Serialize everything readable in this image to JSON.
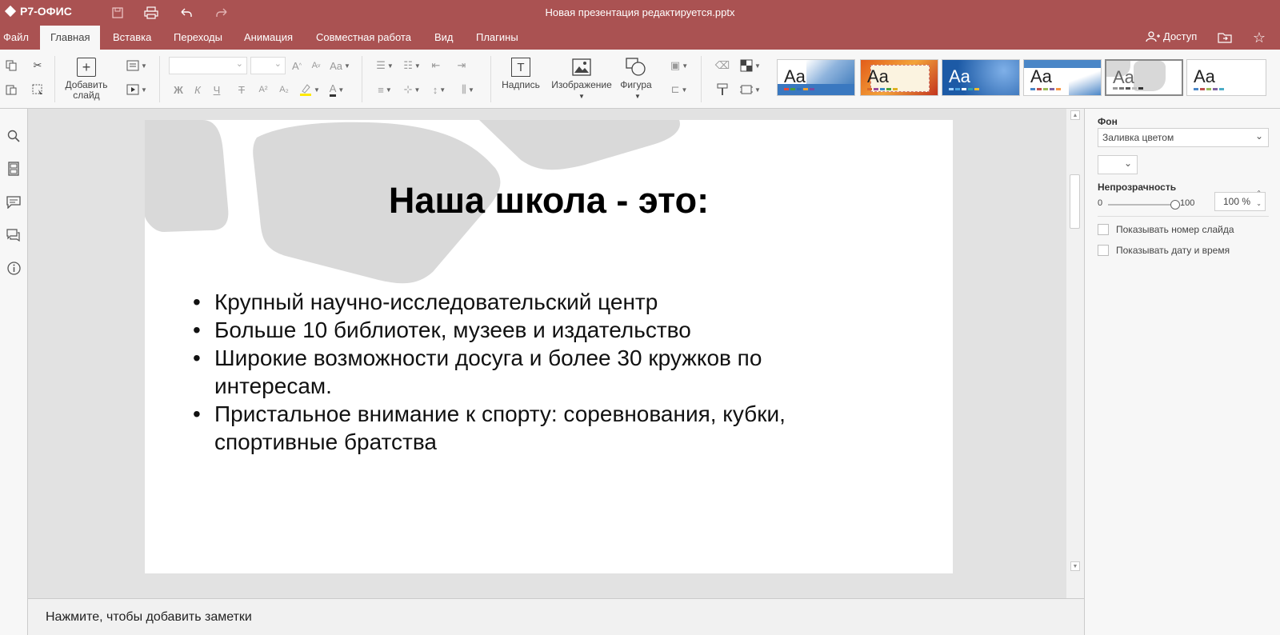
{
  "app": {
    "logo": "Р7-ОФИС",
    "document_title": "Новая презентация редактируется.pptx"
  },
  "title_icons": [
    "save-icon",
    "print-icon",
    "undo-icon",
    "redo-icon"
  ],
  "tabs": [
    {
      "label": "Файл"
    },
    {
      "label": "Главная"
    },
    {
      "label": "Вставка"
    },
    {
      "label": "Переходы"
    },
    {
      "label": "Анимация"
    },
    {
      "label": "Совместная работа"
    },
    {
      "label": "Вид"
    },
    {
      "label": "Плагины"
    }
  ],
  "header_right": {
    "access_label": "Доступ"
  },
  "toolbar": {
    "add_slide_label": "Добавить слайд",
    "format_buttons": [
      "Ж",
      "К",
      "Ч",
      "Т",
      "A²",
      "A₂"
    ],
    "insert_text_label": "Надпись",
    "insert_image_label": "Изображение",
    "insert_shape_label": "Фигура",
    "theme_sample_label": "Aa"
  },
  "themes": [
    {
      "bg": "#2f6fb5"
    },
    {
      "bg": "#d9682a"
    },
    {
      "bg": "#1c5aa6"
    },
    {
      "bg": "#4a86c7"
    },
    {
      "bg": "#d8d8d8"
    },
    {
      "bg": "#ffffff"
    }
  ],
  "slide": {
    "title": "Наша школа - это:",
    "bullets": [
      "Крупный научно-исследовательский центр",
      "Больше 10 библиотек, музеев и издательство",
      "Широкие возможности досуга и более 30 кружков по интересам.",
      "Пристальное внимание к спорту: соревнования, кубки, спортивные братства"
    ]
  },
  "notes": {
    "placeholder": "Нажмите, чтобы добавить заметки"
  },
  "right_panel": {
    "background_label": "Фон",
    "fill_type": "Заливка цветом",
    "opacity_label": "Непрозрачность",
    "opacity_min": "0",
    "opacity_max": "100",
    "opacity_value": "100 %",
    "opacity_level": 1.0,
    "show_slide_number": "Показывать номер слайда",
    "show_date_time": "Показывать дату и время"
  }
}
